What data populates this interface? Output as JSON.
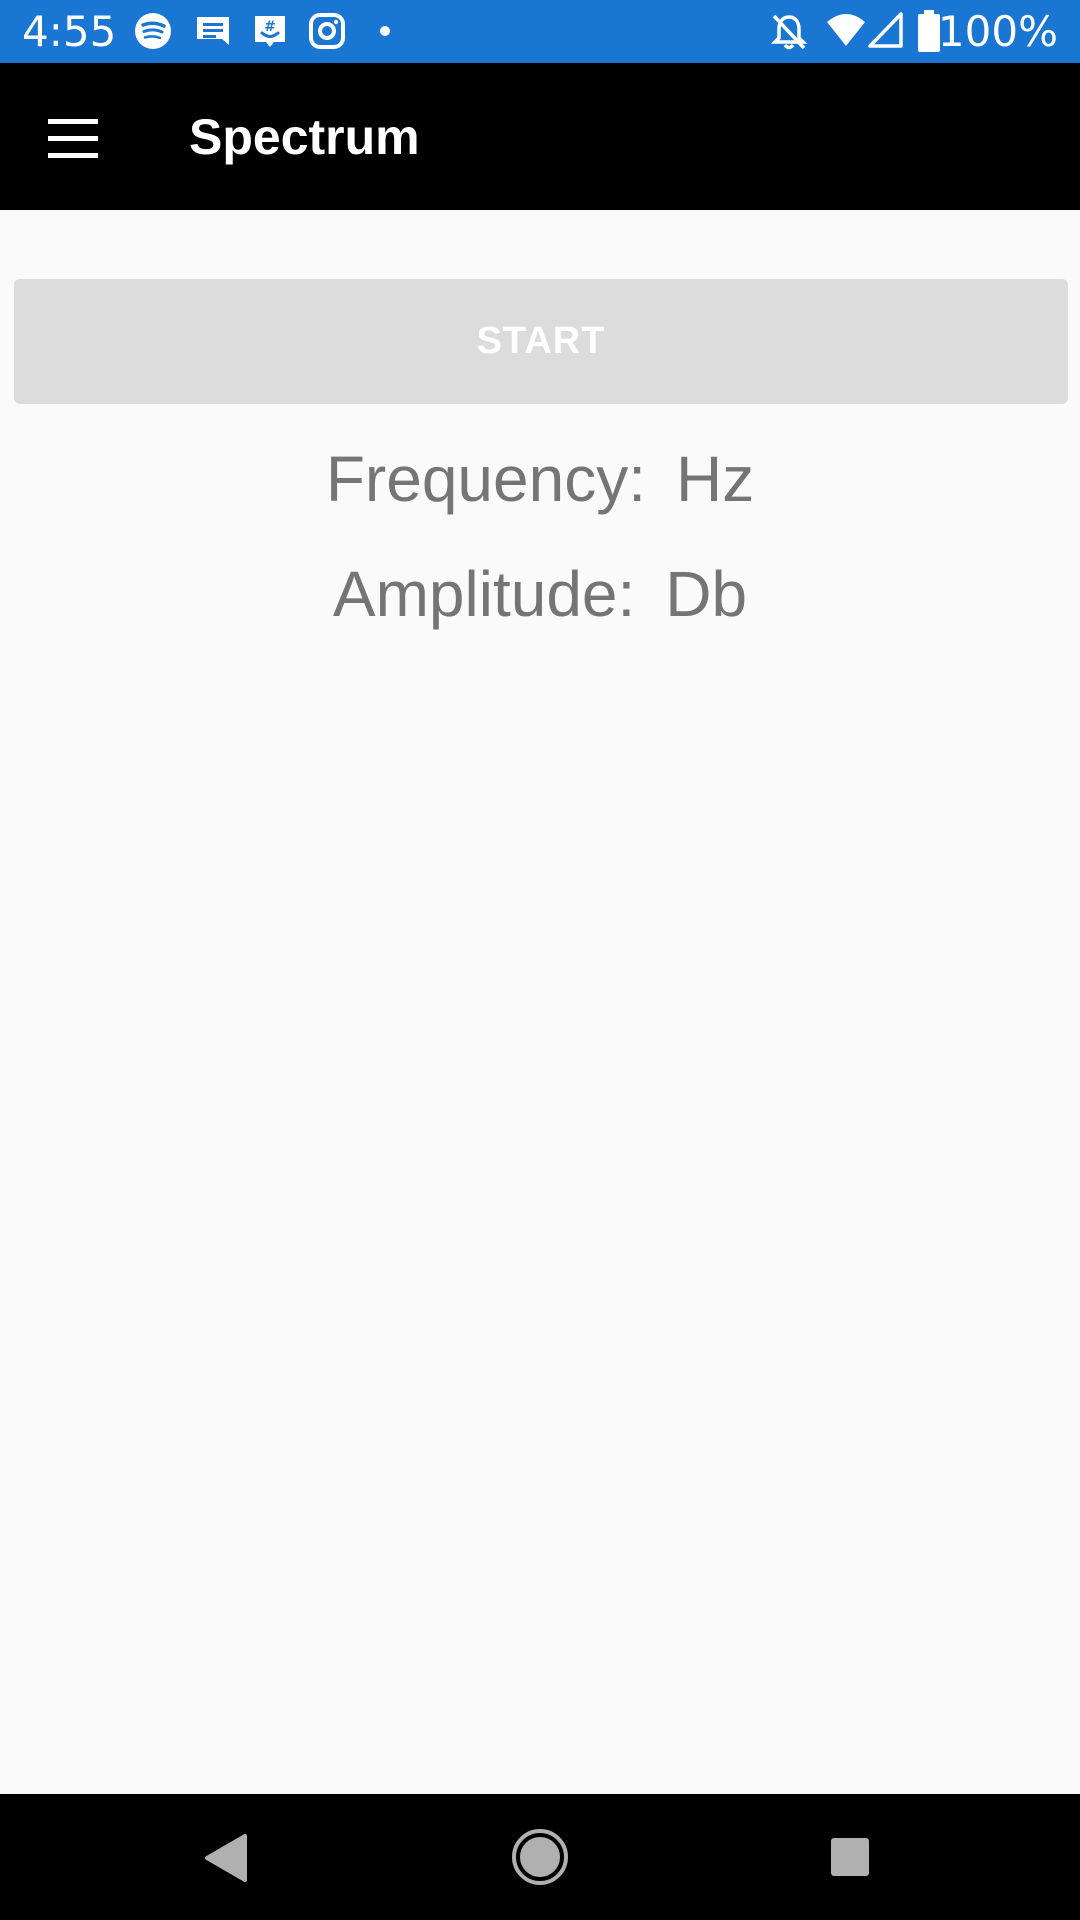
{
  "status_bar": {
    "time": "4:55",
    "battery": "100%",
    "color": "#1976d2",
    "notification_icons": [
      "spotify-icon",
      "messages-icon",
      "groupme-icon",
      "instagram-icon",
      "dot-icon"
    ],
    "system_icons": [
      "bell-off-icon",
      "wifi-icon",
      "signal-icon",
      "battery-icon"
    ]
  },
  "app_bar": {
    "title": "Spectrum",
    "menu_icon": "hamburger-menu-icon"
  },
  "main": {
    "start_label": "START",
    "frequency_label": "Frequency:",
    "frequency_unit": "Hz",
    "amplitude_label": "Amplitude:",
    "amplitude_unit": "Db"
  },
  "nav_bar": {
    "back": "back-icon",
    "home": "home-icon",
    "recents": "recents-icon"
  }
}
